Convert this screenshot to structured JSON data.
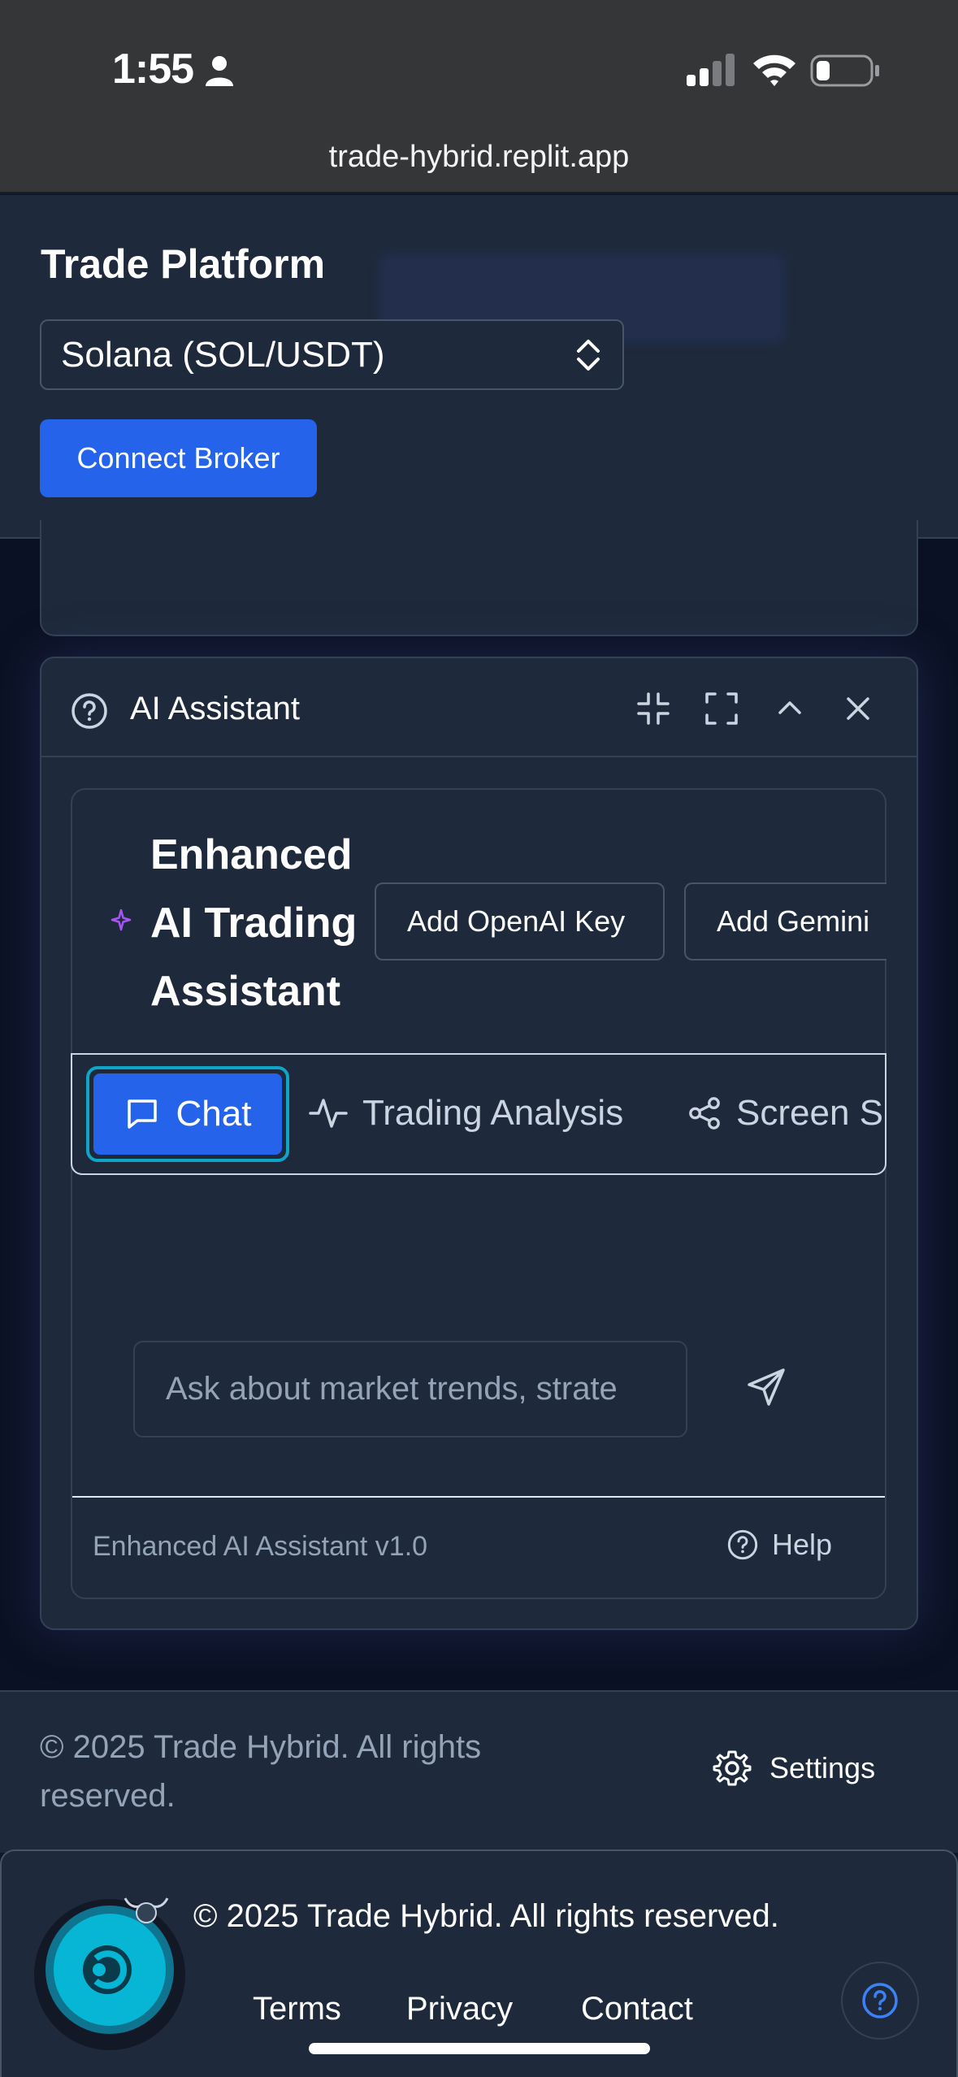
{
  "status_bar": {
    "time": "1:55"
  },
  "browser": {
    "url": "trade-hybrid.replit.app"
  },
  "header": {
    "title": "Trade Platform",
    "pair_select": "Solana (SOL/USDT)",
    "connect_label": "Connect Broker"
  },
  "ai_panel": {
    "title": "AI Assistant",
    "enhanced_title_lines": [
      "Enhanced",
      "AI Trading",
      "Assistant"
    ],
    "openai_key_label": "Add OpenAI Key",
    "gemini_key_label": "Add Gemini",
    "tabs": [
      {
        "label": "Chat",
        "active": true
      },
      {
        "label": "Trading Analysis",
        "active": false
      },
      {
        "label": "Screen S",
        "active": false
      }
    ],
    "input_placeholder": "Ask about market trends, strate",
    "version": "Enhanced AI Assistant v1.0",
    "help_label": "Help"
  },
  "page_footer": {
    "copyright": "© 2025 Trade Hybrid. All rights reserved.",
    "settings_label": "Settings"
  },
  "bottom_bar": {
    "copyright": "© 2025 Trade Hybrid. All rights reserved.",
    "links": [
      "Terms",
      "Privacy",
      "Contact"
    ]
  },
  "colors": {
    "accent": "#2563eb",
    "panel": "#1e293b",
    "border": "#334155",
    "logo": "#06b6d4",
    "sparkle": "#a855f7"
  }
}
